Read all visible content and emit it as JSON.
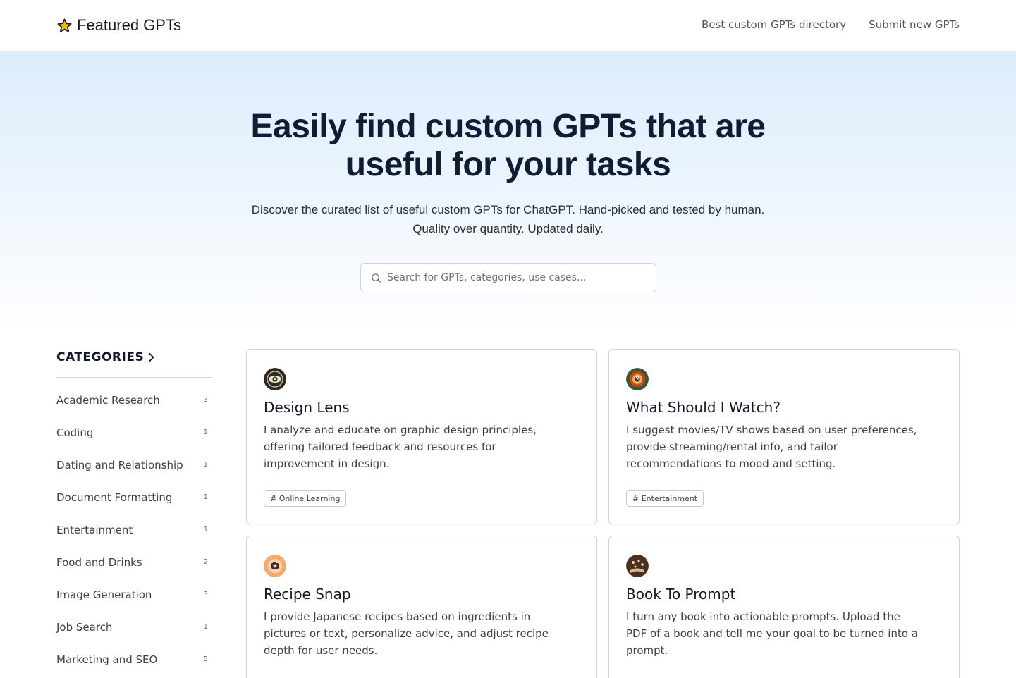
{
  "header": {
    "brand": "Featured GPTs",
    "nav": [
      "Best custom GPTs directory",
      "Submit new GPTs"
    ]
  },
  "hero": {
    "title": "Easily find custom GPTs that are useful for your tasks",
    "subtitle_line1": "Discover the curated list of useful custom GPTs for ChatGPT. Hand-picked and tested by human.",
    "subtitle_line2": "Quality over quantity. Updated daily.",
    "search_placeholder": "Search for GPTs, categories, use cases..."
  },
  "sidebar": {
    "heading": "CATEGORIES",
    "categories": [
      {
        "name": "Academic Research",
        "count": "3"
      },
      {
        "name": "Coding",
        "count": "1"
      },
      {
        "name": "Dating and Relationship",
        "count": "1"
      },
      {
        "name": "Document Formatting",
        "count": "1"
      },
      {
        "name": "Entertainment",
        "count": "1"
      },
      {
        "name": "Food and Drinks",
        "count": "2"
      },
      {
        "name": "Image Generation",
        "count": "3"
      },
      {
        "name": "Job Search",
        "count": "1"
      },
      {
        "name": "Marketing and SEO",
        "count": "5"
      }
    ]
  },
  "cards": [
    {
      "title": "Design Lens",
      "description": "I analyze and educate on graphic design principles, offering tailored feedback and resources for improvement in design.",
      "tag": "# Online Learning",
      "icon": "design-lens-icon"
    },
    {
      "title": "What Should I Watch?",
      "description": "I suggest movies/TV shows based on user preferences, provide streaming/rental info, and tailor recommendations to mood and setting.",
      "tag": "# Entertainment",
      "icon": "what-should-i-watch-icon"
    },
    {
      "title": "Recipe Snap",
      "description": "I provide Japanese recipes based on ingredients in pictures or text, personalize advice, and adjust recipe depth for user needs.",
      "tag": "",
      "icon": "recipe-snap-icon"
    },
    {
      "title": "Book To Prompt",
      "description": "I turn any book into actionable prompts. Upload the PDF of a book and tell me your goal to be turned into a prompt.",
      "tag": "",
      "icon": "book-to-prompt-icon"
    }
  ],
  "colors": {
    "accent_title": "#0f1c33",
    "hero_gradient_top": "#dcecfb",
    "star": "#f5b800"
  }
}
